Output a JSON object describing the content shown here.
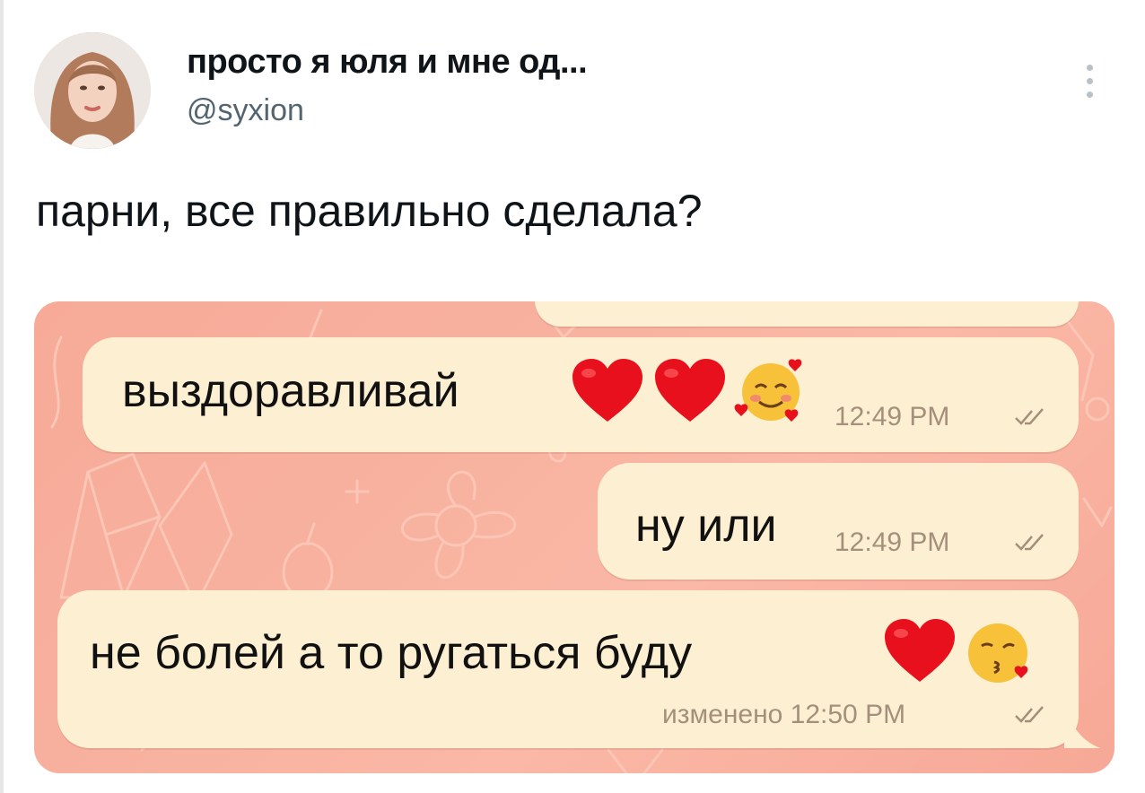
{
  "tweet": {
    "display_name": "просто я юля и мне од...",
    "handle": "@syxion",
    "text": "парни, все правильно сделала?"
  },
  "chat": {
    "messages": [
      {
        "text": "выздоравливай",
        "emojis": [
          "red-heart",
          "red-heart",
          "smiling-face-with-hearts"
        ],
        "time": "12:49 PM",
        "status_icon": "double-check-icon"
      },
      {
        "text": "ну или",
        "time": "12:49 PM",
        "status_icon": "double-check-icon"
      },
      {
        "text": "не болей а то ругаться буду",
        "emojis": [
          "red-heart",
          "face-blowing-a-kiss"
        ],
        "time": "изменено 12:50 PM",
        "status_icon": "double-check-icon"
      }
    ]
  },
  "colors": {
    "chat_wallpaper": "#f8b2a0",
    "bubble": "#fdf0d2",
    "time_text": "#a48f7c",
    "handle_text": "#536471"
  }
}
